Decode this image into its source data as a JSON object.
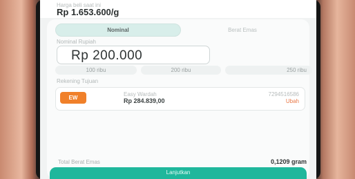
{
  "header": {
    "price_label": "Harga beli saat ini",
    "price_value": "Rp 1.653.600/g"
  },
  "tabs": [
    {
      "label": "Nominal",
      "active": true
    },
    {
      "label": "Berat Emas",
      "active": false
    }
  ],
  "amount": {
    "label": "Nominal Rupiah",
    "value": "Rp 200.000"
  },
  "quick_amounts": [
    "100 ribu",
    "200 ribu",
    "250 ribu"
  ],
  "account": {
    "section_label": "Rekening Tujuan",
    "badge": "EW",
    "name": "Easy Wardah",
    "balance": "Rp 284.839,00",
    "number": "7294516586",
    "change_label": "Ubah"
  },
  "summary": {
    "total_label": "Total Berat Emas",
    "total_value": "0,1209 gram"
  },
  "cta": {
    "label": "Lanjutkan"
  },
  "colors": {
    "accent": "#1fb79c",
    "badge": "#f0802a",
    "tab_active": "#d8eeea"
  }
}
